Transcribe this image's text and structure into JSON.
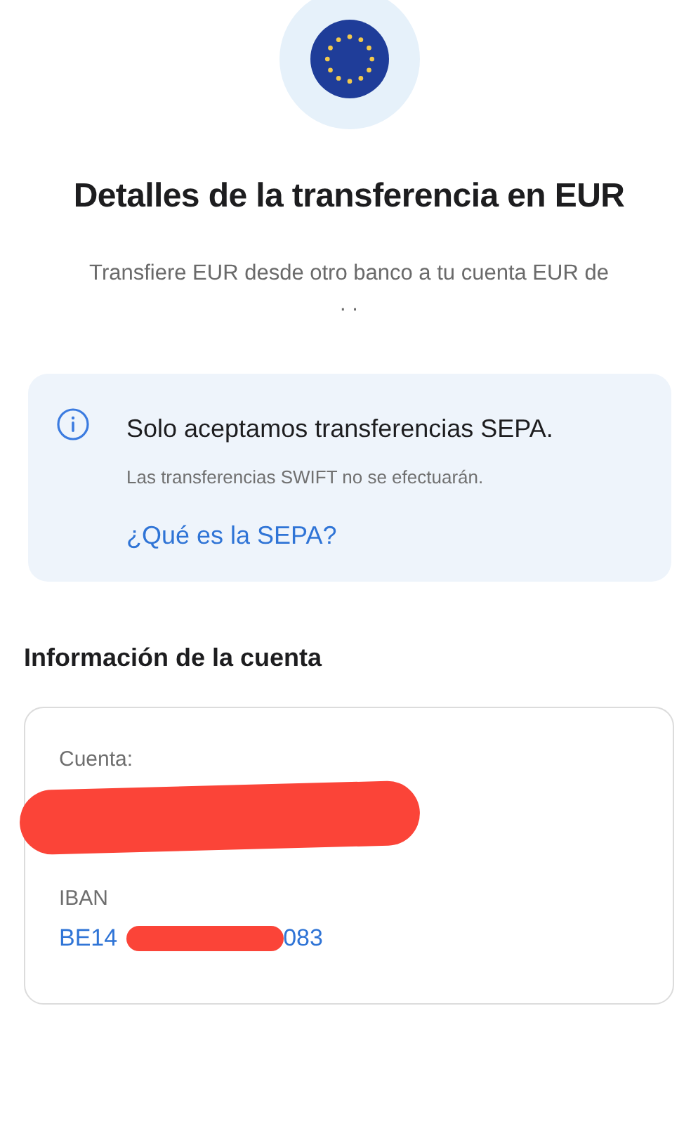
{
  "header": {
    "title": "Detalles de la transferencia en EUR",
    "subtitle_lines": [
      "Transfiere EUR desde otro banco a tu cuenta EUR de",
      ". ."
    ]
  },
  "notice": {
    "title": "Solo aceptamos transferencias SEPA.",
    "body": "Las transferencias SWIFT no se efectuarán.",
    "link": "¿Qué es la SEPA?"
  },
  "account_info": {
    "heading": "Información de la cuenta",
    "fields": [
      {
        "kind": "redacted",
        "label": "Cuenta:"
      },
      {
        "kind": "iban",
        "label": "IBAN",
        "value_start": "BE14",
        "value_end": "083"
      }
    ]
  }
}
